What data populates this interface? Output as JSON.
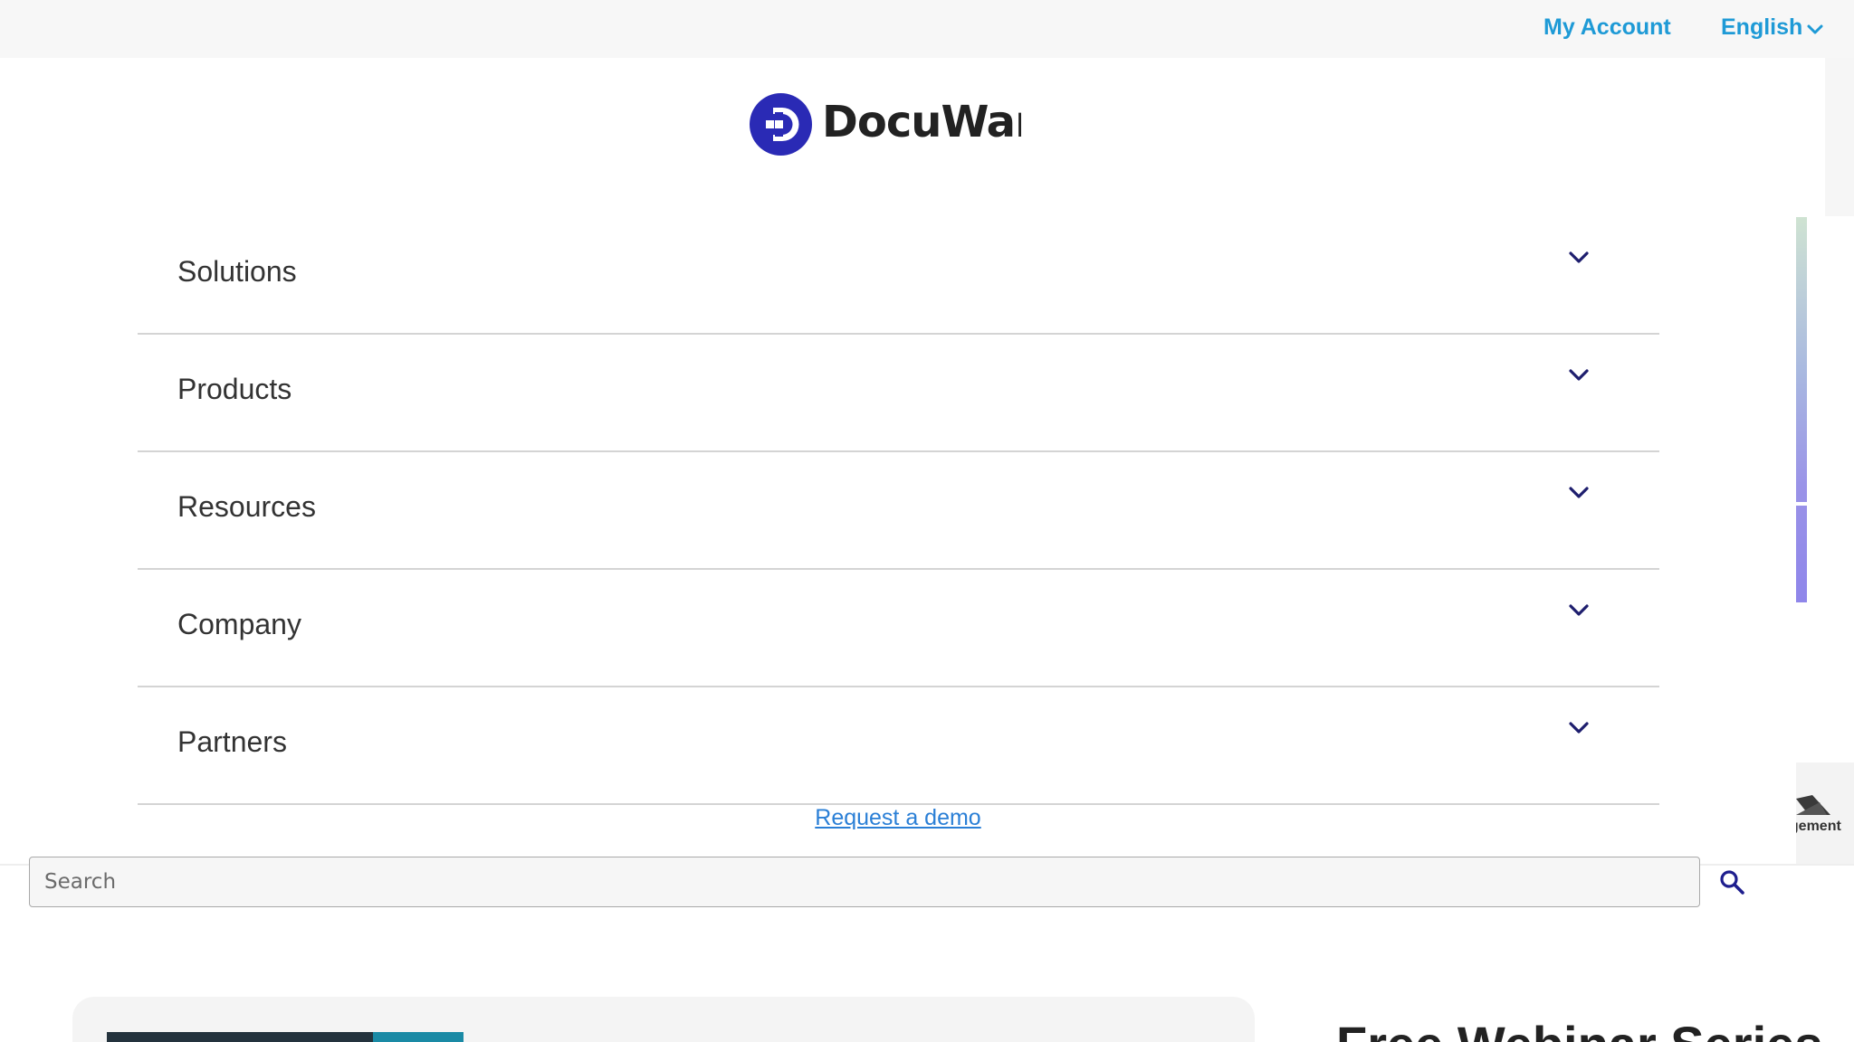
{
  "topbar": {
    "my_account": "My Account",
    "language": "English"
  },
  "logo": {
    "text": "DocuWare"
  },
  "menu": {
    "items": [
      {
        "label": "Solutions"
      },
      {
        "label": "Products"
      },
      {
        "label": "Resources"
      },
      {
        "label": "Company"
      },
      {
        "label": "Partners"
      }
    ]
  },
  "demo_link": "Request a demo",
  "search": {
    "placeholder": "Search",
    "value": ""
  },
  "side_widget": {
    "text": "Management"
  },
  "promo": {
    "title": "Free Webinar Series"
  },
  "colors": {
    "accent_link": "#1e9ad6",
    "brand": "#2a2ab5",
    "chevron": "#1e1e6e"
  },
  "icons": {
    "language_chevron": "chevron-down-icon",
    "menu_chevron": "chevron-down-icon",
    "search": "search-icon"
  }
}
